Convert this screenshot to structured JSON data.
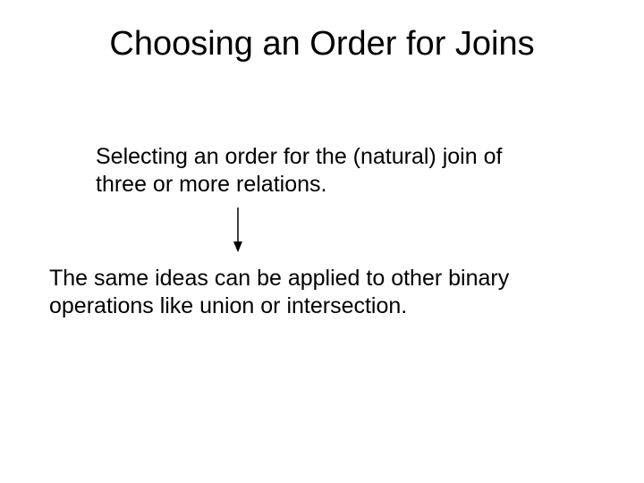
{
  "slide": {
    "title": "Choosing an Order for Joins",
    "paragraph1": "Selecting an order for the (natural) join of three or more relations.",
    "paragraph2": "The same ideas can be applied to other binary operations like union or intersection."
  }
}
